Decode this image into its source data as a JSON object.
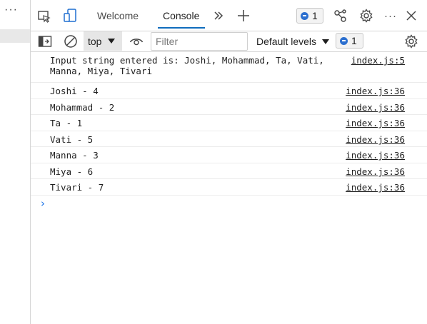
{
  "left_pane": {
    "more_label": "···"
  },
  "tabs": [
    {
      "label": "Welcome"
    },
    {
      "label": "Console",
      "active": true
    }
  ],
  "tabbar": {
    "more_tabs_icon": "double-chevron-right-icon",
    "add_tab_icon": "plus-icon",
    "issues_count": "1",
    "close_icon": "close-icon"
  },
  "toolbar": {
    "context": "top",
    "filter_placeholder": "Filter",
    "filter_value": "",
    "levels_label": "Default levels",
    "issues_count": "1"
  },
  "console": {
    "messages": [
      {
        "text": "Input string entered is: Joshi, Mohammad, Ta, Vati,\nManna, Miya, Tivari",
        "source": "index.js:5"
      },
      {
        "text": "Joshi - 4",
        "source": "index.js:36"
      },
      {
        "text": "Mohammad - 2",
        "source": "index.js:36"
      },
      {
        "text": "Ta - 1",
        "source": "index.js:36"
      },
      {
        "text": "Vati - 5",
        "source": "index.js:36"
      },
      {
        "text": "Manna - 3",
        "source": "index.js:36"
      },
      {
        "text": "Miya - 6",
        "source": "index.js:36"
      },
      {
        "text": "Tivari - 7",
        "source": "index.js:36"
      }
    ],
    "prompt": "›"
  },
  "colors": {
    "accent": "#0f6cbd",
    "badge_dot": "#2c6fcf",
    "prompt": "#1a73e8"
  }
}
